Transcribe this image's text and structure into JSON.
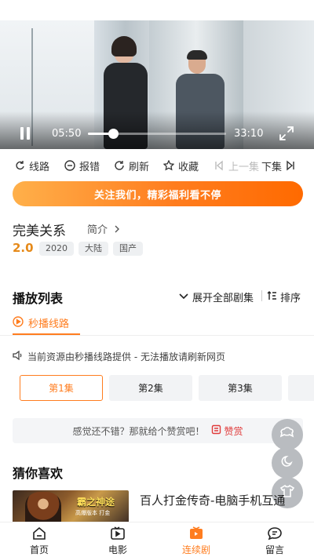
{
  "video": {
    "current_time": "05:50",
    "total_time": "33:10",
    "progress": 0.18
  },
  "actions": [
    {
      "label": "线路",
      "icon": "route-icon"
    },
    {
      "label": "报错",
      "icon": "report-icon"
    },
    {
      "label": "刷新",
      "icon": "refresh-icon"
    },
    {
      "label": "收藏",
      "icon": "star-icon"
    },
    {
      "label": "上一集",
      "icon": "prev-episode-icon"
    },
    {
      "label": "下集",
      "icon": "next-episode-icon"
    }
  ],
  "banner": {
    "text": "关注我们，精彩福利看不停"
  },
  "show": {
    "title": "完美关系",
    "intro_label": "简介",
    "rating": "2.0",
    "tags": [
      "2020",
      "大陆",
      "国产"
    ]
  },
  "playlist": {
    "title": "播放列表",
    "expand_label": "展开全部剧集",
    "sort_label": "排序",
    "line_tab": "秒播线路",
    "notice": "当前资源由秒播线路提供 - 无法播放请刷新网页",
    "episodes": [
      "第1集",
      "第2集",
      "第3集"
    ],
    "active_episode": 0
  },
  "like": {
    "text": "感觉还不错？那就给个赞赏吧！",
    "button": "赞赏"
  },
  "recommend": {
    "title": "猜你喜欢",
    "items": [
      {
        "title": "百人打金传奇-电脑手机互通",
        "thumb_title": "霸之神途",
        "thumb_sub": "高爆版本 打金"
      }
    ]
  },
  "bottom_nav": [
    {
      "label": "首页",
      "icon": "home-icon"
    },
    {
      "label": "电影",
      "icon": "movie-icon"
    },
    {
      "label": "连续剧",
      "icon": "tv-series-icon"
    },
    {
      "label": "留言",
      "icon": "message-icon"
    }
  ],
  "active_nav": 2,
  "colors": {
    "accent": "#ff7d1f",
    "rating": "#e68a1a",
    "like": "#e03a3a"
  }
}
